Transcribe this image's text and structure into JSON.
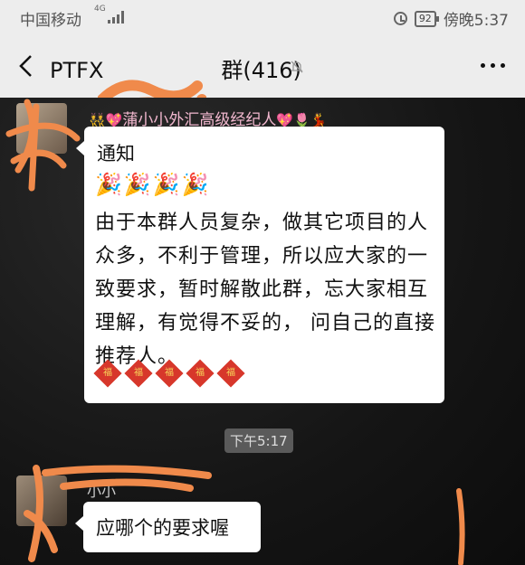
{
  "status_bar": {
    "carrier": "中国移动",
    "network": "4G",
    "battery": "92",
    "time": "傍晚5:37"
  },
  "header": {
    "title": "PTFX",
    "suffix": "群(416)",
    "back_icon": "chevron-left-icon",
    "mute_icon": "bell-off-icon",
    "more_icon": "more-icon"
  },
  "messages": [
    {
      "sender": "蒲小小外汇高级经纪人",
      "sender_emoji_left": "👯💖",
      "sender_emoji_right": "💖🌷💃",
      "title": "通知",
      "confetti": "🎉🎉🎉🎉",
      "body": "由于本群人员复杂，做其它项目的人众多，不利于管理，所以应大家的一致要求，暂时解散此群，忘大家相互理解，有觉得不妥的， 问自己的直接推荐人。",
      "fu_count": 5,
      "fu_char": "福"
    },
    {
      "sender": "小小",
      "text": "应哪个的要求喔"
    }
  ],
  "timestamp": "下午5:17"
}
